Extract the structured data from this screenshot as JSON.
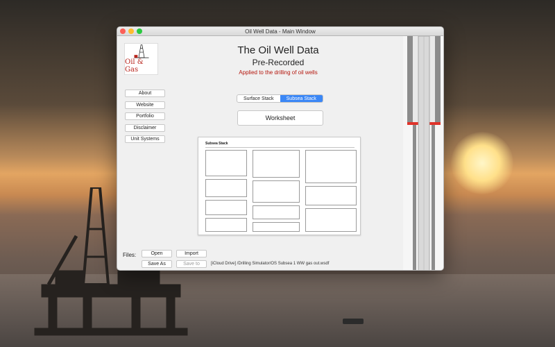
{
  "window": {
    "title": "Oil Well Data - Main Window"
  },
  "logo": {
    "text": "Oil & Gas"
  },
  "sidebar": {
    "items": [
      {
        "label": "About"
      },
      {
        "label": "Website"
      },
      {
        "label": "Portfolio"
      },
      {
        "label": "Disclaimer"
      },
      {
        "label": "Unit Systems"
      }
    ]
  },
  "header": {
    "title": "The Oil Well Data",
    "subtitle": "Pre-Recorded",
    "tagline": "Applied to the drilling of oil wells"
  },
  "stack_toggle": {
    "options": [
      "Surface Stack",
      "Subsea Stack"
    ],
    "selected": "Subsea Stack"
  },
  "worksheet_button": {
    "label": "Worksheet"
  },
  "worksheet_preview": {
    "title": "Subsea Stack"
  },
  "files": {
    "label": "Files:",
    "open": "Open",
    "import": "Import",
    "save_as": "Save As",
    "save_to": "Save to",
    "path": "[iCloud Drive] /Drilling Simulator/OS Subsea 1 WW gas out.wsdf"
  },
  "colors": {
    "accent": "#3b87f6",
    "tagline": "#b4150c",
    "logo_text": "#b8241c",
    "pipe_marker": "#e0332a"
  }
}
